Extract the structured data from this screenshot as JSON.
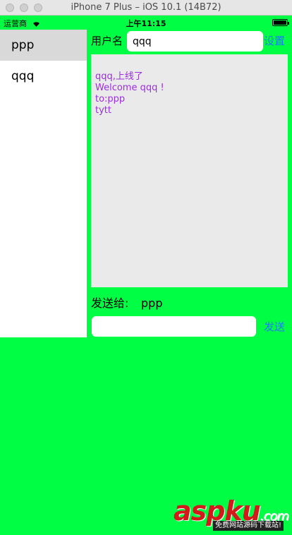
{
  "window": {
    "title": "iPhone 7 Plus – iOS 10.1 (14B72)"
  },
  "status_bar": {
    "carrier": "运营商",
    "time": "上午11:15"
  },
  "sidebar": {
    "items": [
      {
        "label": "ppp",
        "selected": true
      },
      {
        "label": "qqq",
        "selected": false
      }
    ]
  },
  "header": {
    "user_label": "用户名",
    "user_value": "qqq",
    "settings_label": "设置"
  },
  "messages": {
    "color": "#9b2de0",
    "lines": [
      "qqq,上线了",
      "Welcome qqq !",
      "to:ppp",
      "tytt"
    ]
  },
  "compose": {
    "send_to_label": "发送给:",
    "recipient": "ppp",
    "message_value": "",
    "send_label": "发送"
  },
  "watermark": {
    "logo": "aspku",
    "domain": ".com",
    "tagline": "免费网站源码下载站!"
  },
  "colors": {
    "background": "#00ff44",
    "accent": "#1a7cf0"
  }
}
